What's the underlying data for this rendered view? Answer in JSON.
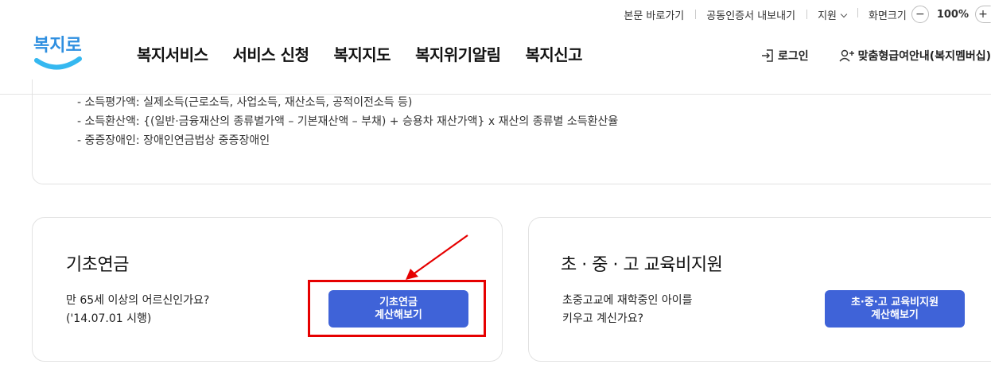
{
  "header": {
    "logo_text": "복지로",
    "util_links": [
      {
        "label": "본문 바로가기"
      },
      {
        "label": "공동인증서 내보내기"
      },
      {
        "label": "지원"
      }
    ],
    "zoom": {
      "label": "화면크기",
      "minus": "−",
      "value": "100%",
      "plus": "+"
    },
    "gnb": [
      "복지서비스",
      "서비스 신청",
      "복지지도",
      "복지위기알림",
      "복지신고"
    ],
    "login_label": "로그인",
    "member_label": "맞춤형급여안내(복지멤버십)"
  },
  "criteria": {
    "items": [
      "- 소득평가액: 실제소득(근로소득, 사업소득, 재산소득, 공적이전소득 등)",
      "- 소득환산액: {(일반·금융재산의 종류별가액 – 기본재산액 – 부채) + 승용차 재산가액} x 재산의 종류별 소득환산율",
      "- 중증장애인: 장애인연금법상 중증장애인"
    ]
  },
  "cards": [
    {
      "title": "기초연금",
      "desc_line1": "만 65세 이상의 어르신인가요?",
      "desc_line2": "('14.07.01 시행)",
      "button_line1": "기초연금",
      "button_line2": "계산해보기"
    },
    {
      "title": "초 · 중 · 고 교육비지원",
      "desc_line1": "초중고교에 재학중인 아이를",
      "desc_line2": "키우고 계신가요?",
      "button_line1": "초·중·고 교육비지원",
      "button_line2": "계산해보기"
    }
  ],
  "colors": {
    "accent": "#3f63d8",
    "highlight": "#e60000",
    "logo_blue": "#2f8fe0",
    "logo_smile": "#35b8f0"
  }
}
